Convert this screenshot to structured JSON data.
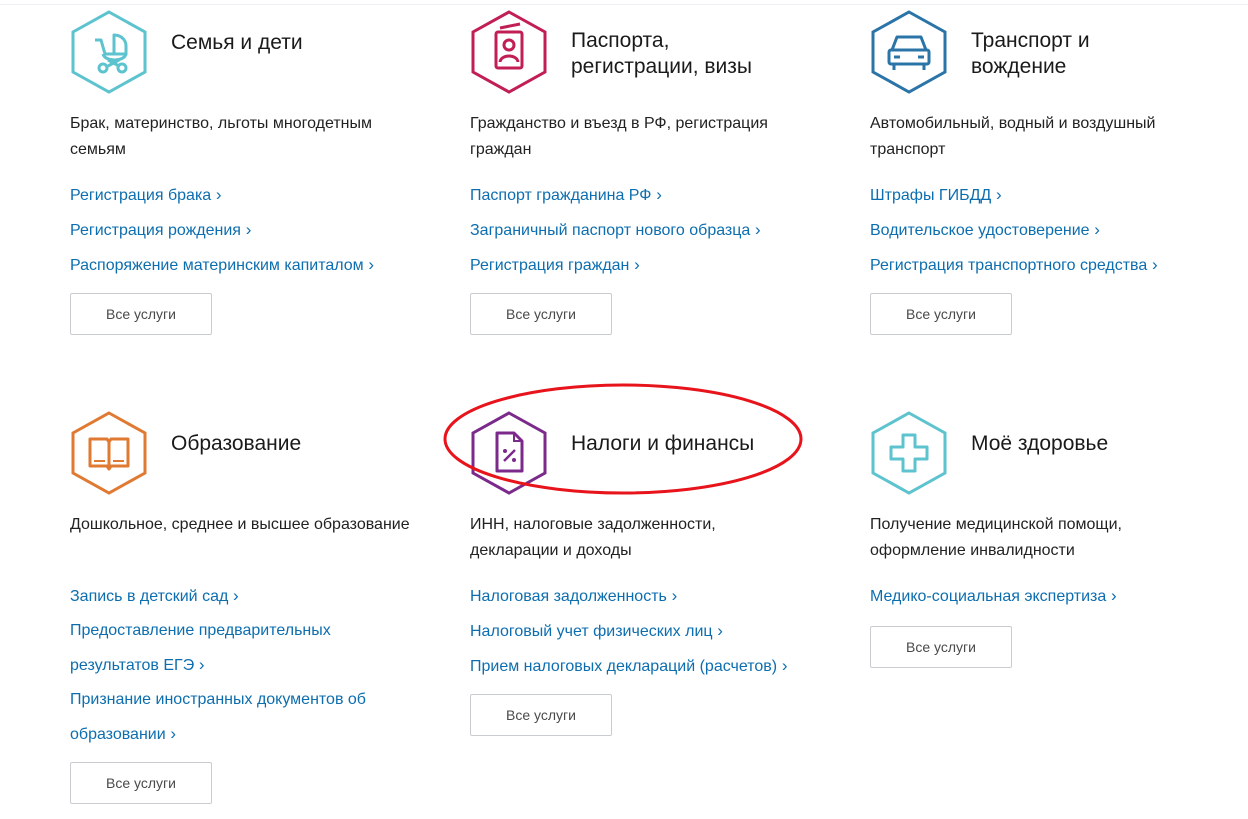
{
  "all_services_label": "Все услуги",
  "colors": {
    "link": "#0d6eaf",
    "highlight": "#e8141b"
  },
  "categories": [
    {
      "title_line1": "Семья и дети",
      "title_line2": "",
      "icon": "baby-stroller-icon",
      "icon_color": "#5cc3cf",
      "description": "Брак, материнство, льготы многодетным семьям",
      "links": [
        "Регистрация брака",
        "Регистрация рождения",
        "Распоряжение материнским капиталом"
      ]
    },
    {
      "title_line1": "Паспорта,",
      "title_line2": "регистрации, визы",
      "icon": "passport-icon",
      "icon_color": "#c21e56",
      "description": "Гражданство и въезд в РФ, регистрация граждан",
      "links": [
        "Паспорт гражданина РФ",
        "Заграничный паспорт нового образца",
        "Регистрация граждан"
      ]
    },
    {
      "title_line1": "Транспорт и",
      "title_line2": "вождение",
      "icon": "car-icon",
      "icon_color": "#2a74a8",
      "description": "Автомобильный, водный и воздушный транспорт",
      "links": [
        "Штрафы ГИБДД",
        "Водительское удостоверение",
        "Регистрация транспортного средства"
      ]
    },
    {
      "title_line1": "Образование",
      "title_line2": "",
      "icon": "book-icon",
      "icon_color": "#e07a32",
      "description": "Дошкольное, среднее и высшее образование",
      "links": [
        "Запись в детский сад",
        "Предоставление предварительных результатов ЕГЭ",
        "Признание иностранных документов об образовании"
      ]
    },
    {
      "title_line1": "Налоги и финансы",
      "title_line2": "",
      "icon": "tax-document-icon",
      "icon_color": "#7b2a8c",
      "description": "ИНН, налоговые задолженности, декларации и доходы",
      "links": [
        "Налоговая задолженность",
        "Налоговый учет физических лиц",
        "Прием налоговых деклараций (расчетов)"
      ]
    },
    {
      "title_line1": "Моё здоровье",
      "title_line2": "",
      "icon": "medical-cross-icon",
      "icon_color": "#5cc3cf",
      "description": "Получение медицинской помощи, оформление инвалидности",
      "links": [
        "Медико-социальная экспертиза"
      ]
    }
  ]
}
